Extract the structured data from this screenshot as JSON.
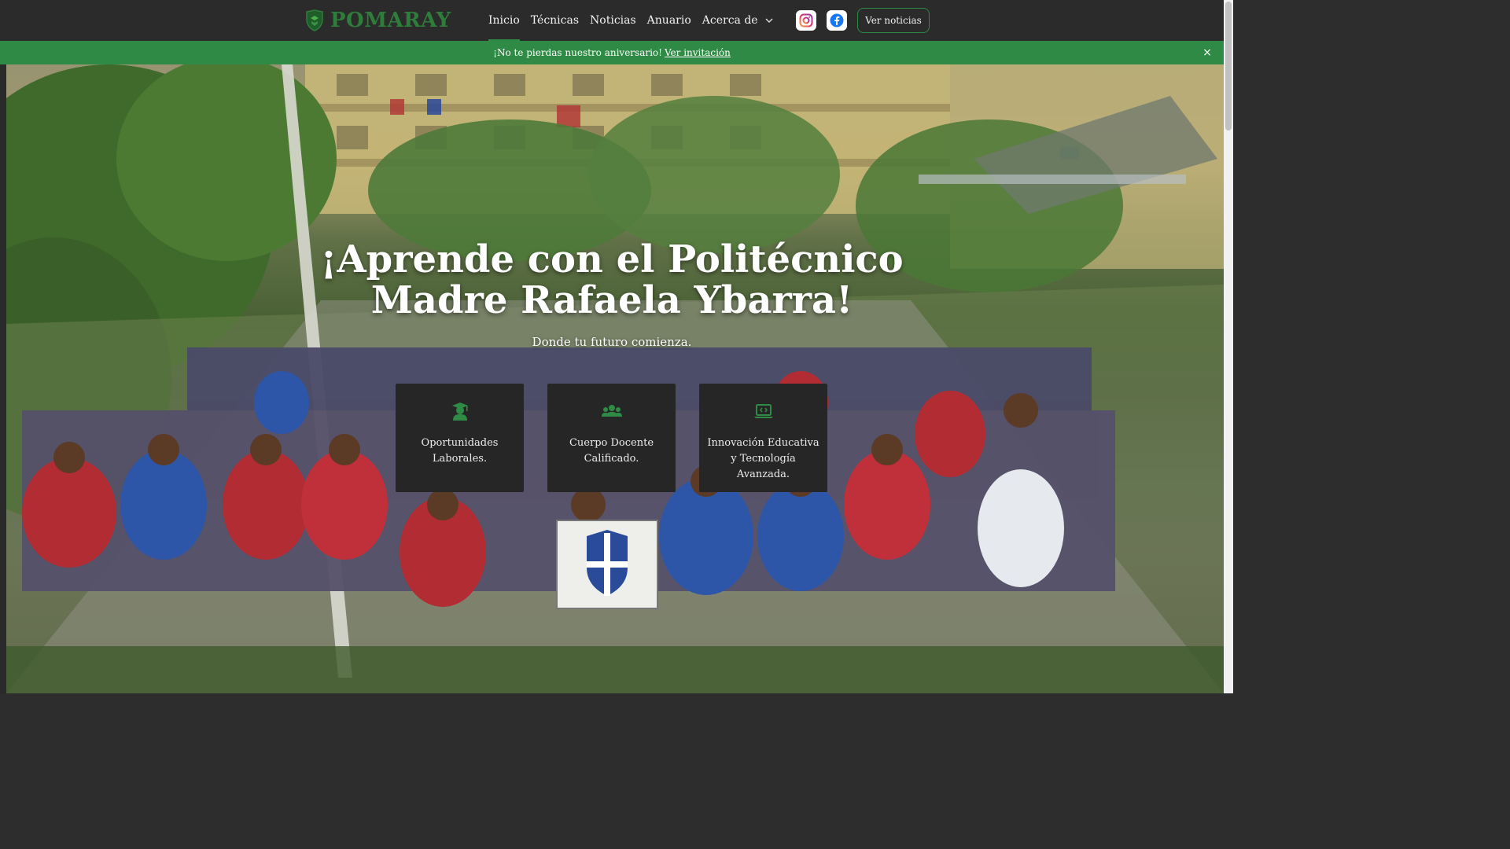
{
  "nav": {
    "brand": "POMARAY",
    "links": [
      {
        "label": "Inicio",
        "active": true
      },
      {
        "label": "Técnicas",
        "active": false
      },
      {
        "label": "Noticias",
        "active": false
      },
      {
        "label": "Anuario",
        "active": false
      },
      {
        "label": "Acerca de",
        "active": false,
        "dropdown": true
      }
    ],
    "social": [
      {
        "icon": "instagram-icon"
      },
      {
        "icon": "facebook-icon"
      }
    ],
    "cta_label": "Ver noticias"
  },
  "announcement": {
    "text": "¡No te pierdas nuestro aniversario!",
    "link_label": "Ver invitación",
    "close_label": "×"
  },
  "hero": {
    "title": "¡Aprende con el Politécnico Madre Rafaela Ybarra!",
    "subtitle": "Donde tu futuro comienza.",
    "cards": [
      {
        "icon": "graduate-icon",
        "label": "Oportunidades Laborales."
      },
      {
        "icon": "people-group-icon",
        "label": "Cuerpo Docente Calificado."
      },
      {
        "icon": "laptop-code-icon",
        "label": "Innovación Educativa y Tecnología Avanzada."
      }
    ]
  },
  "colors": {
    "brand_green": "#2e7d3a",
    "announce_green": "#2f8a45",
    "nav_bg": "#2b2b2b",
    "card_bg": "#262626"
  }
}
